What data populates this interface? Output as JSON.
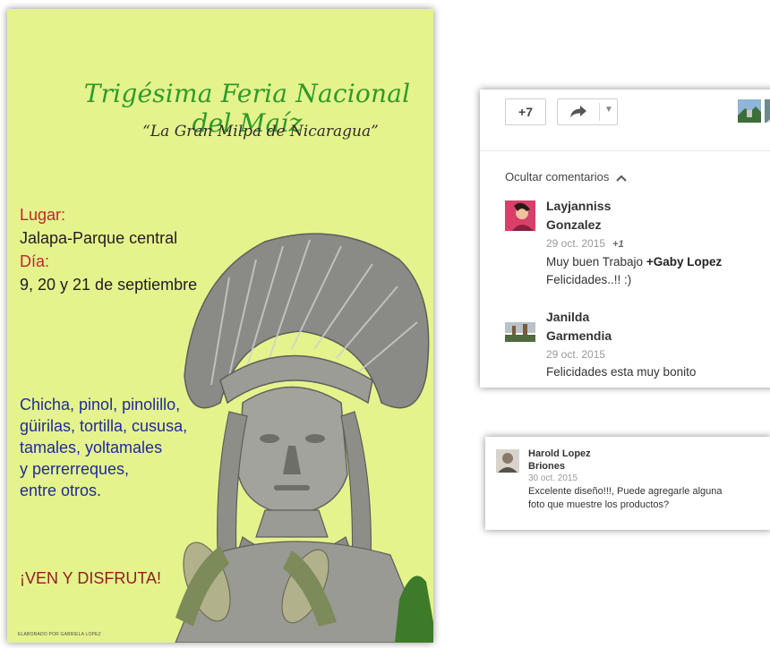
{
  "poster": {
    "title": "Trigésima Feria Nacional del Maíz",
    "subtitle": "“La Gran Milpa de Nicaragua”",
    "lugar_label": "Lugar:",
    "lugar_value": "Jalapa-Parque central",
    "dia_label": "Día:",
    "dia_value": "9, 20 y 21 de septiembre",
    "foods": [
      "Chicha, pinol, pinolillo,",
      "güirilas, tortilla, cususa,",
      "tamales,  yoltamales",
      "y perrerreques,",
      "entre otros."
    ],
    "cta": "¡VEN Y DISFRUTA!",
    "credit": "ELABORADO POR GABRIELA LOPEZ"
  },
  "toolbar": {
    "plus_label": "+7"
  },
  "comments_toggle": "Ocultar comentarios",
  "comments": [
    {
      "name_line1": "Layjanniss",
      "name_line2": "Gonzalez",
      "date": "29 oct. 2015",
      "plus_one": "+1",
      "text_before": "Muy buen Trabajo ",
      "mention": "+Gaby Lopez",
      "text_line2": "Felicidades..!! :)"
    },
    {
      "name_line1": "Janilda",
      "name_line2": "Garmendia",
      "date": "29 oct. 2015",
      "text": "Felicidades esta muy bonito"
    }
  ],
  "comment_card2": {
    "name_line1": "Harold Lopez",
    "name_line2": "Briones",
    "date": "30 oct. 2015",
    "text_line1": "Excelente diseño!!!, Puede agregarle alguna",
    "text_line2": "foto que muestre los productos?"
  },
  "colors": {
    "poster_bg": "#e5f38d",
    "title_green": "#2f9a2a",
    "label_red": "#c0262b",
    "food_blue": "#1f2a9c",
    "cta_maroon": "#8f1f23"
  }
}
